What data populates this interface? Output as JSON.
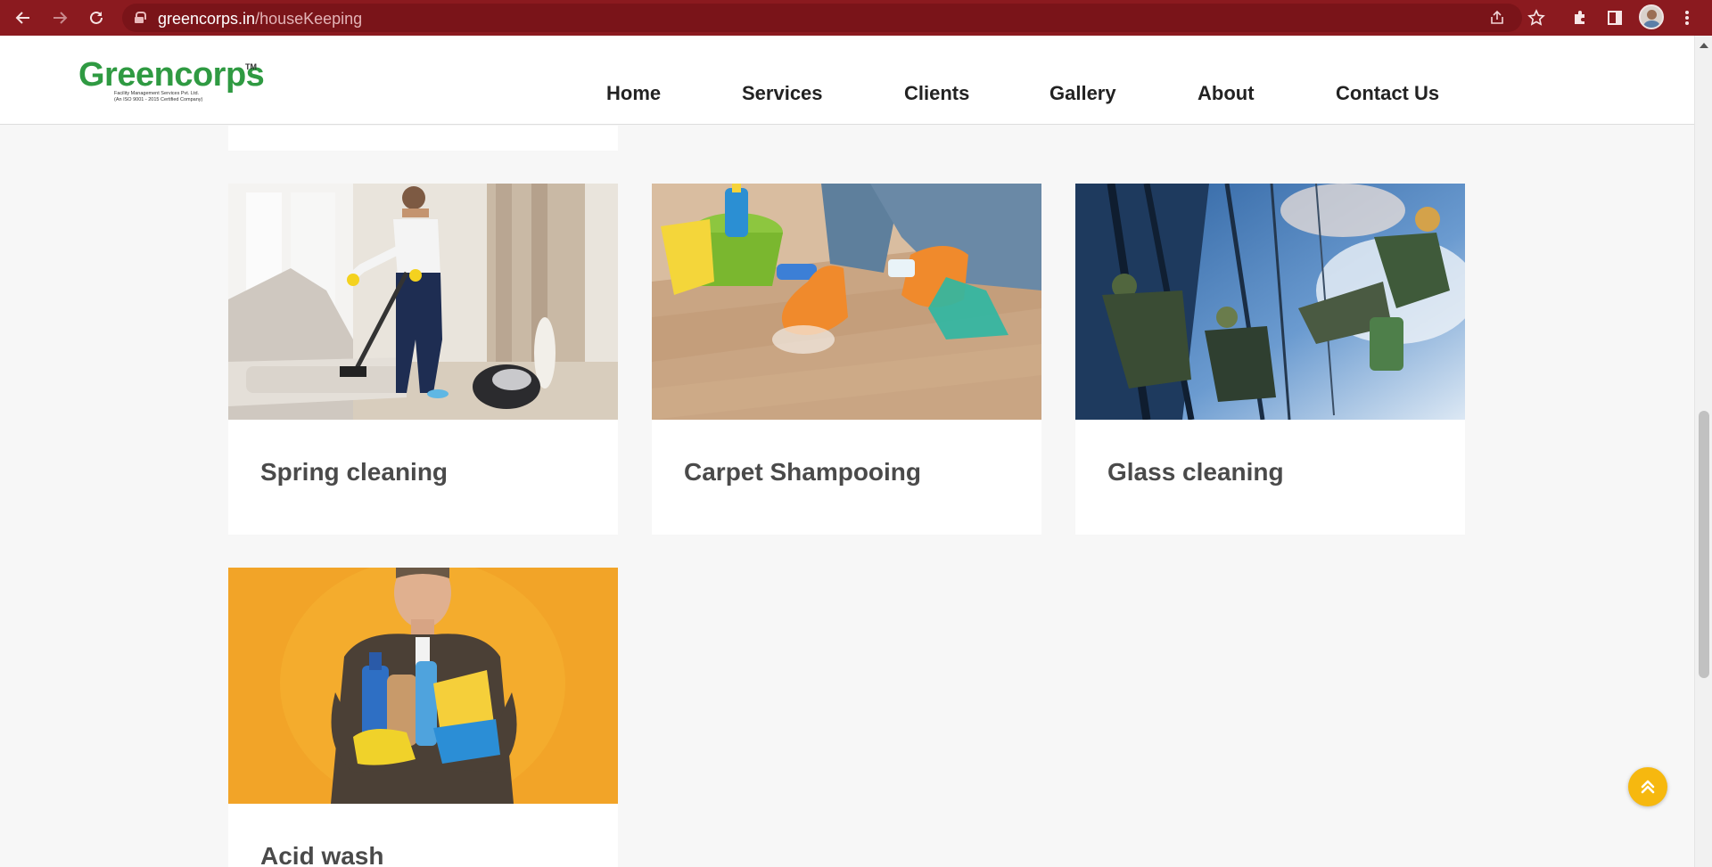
{
  "browser": {
    "url_host": "greencorps.in",
    "url_path": "/houseKeeping",
    "icons": {
      "back": "arrow-left-icon",
      "forward": "arrow-right-icon",
      "reload": "reload-icon",
      "share": "share-icon",
      "bookmark": "star-icon",
      "extensions": "puzzle-icon",
      "side_panel": "side-panel-icon",
      "profile": "avatar",
      "menu": "kebab-menu-icon"
    }
  },
  "site": {
    "logo": {
      "name": "Greencorps",
      "tm": "TM",
      "tagline_1": "Facility Management Services Pvt. Ltd.",
      "tagline_2": "(An ISO 9001 - 2015 Certified Company)",
      "color": "#2f9a42"
    },
    "nav": [
      "Home",
      "Services",
      "Clients",
      "Gallery",
      "About",
      "Contact Us"
    ]
  },
  "services": [
    {
      "title": "Spring cleaning",
      "image": "man vacuuming sofa photo"
    },
    {
      "title": "Carpet Shampooing",
      "image": "gloved hands cleaning wooden floor photo"
    },
    {
      "title": "Glass cleaning",
      "image": "rope-access workers cleaning glass facade photo"
    },
    {
      "title": "Acid wash",
      "image": "cleaner holding cleaning products photo"
    }
  ],
  "back_to_top": {
    "icon": "double-chevron-up-icon",
    "color": "#f6b80f"
  }
}
